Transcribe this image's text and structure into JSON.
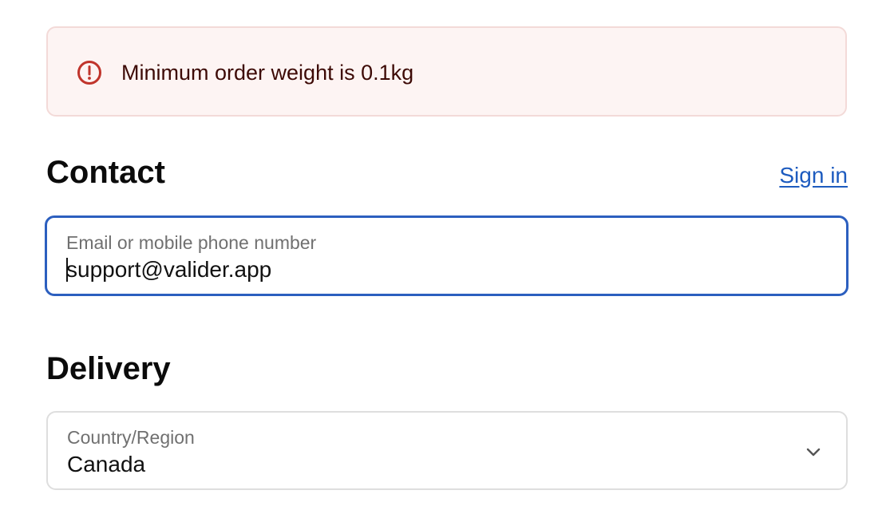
{
  "error_banner": {
    "icon": "alert-circle-icon",
    "message": "Minimum order weight is 0.1kg",
    "colors": {
      "background": "#fdf4f3",
      "border": "#f3dad8",
      "icon": "#c0342b",
      "text": "#3d0a06"
    }
  },
  "contact": {
    "heading": "Contact",
    "sign_in_label": "Sign in",
    "email_field": {
      "label": "Email or mobile phone number",
      "value": "support@valider.app",
      "focused": true
    }
  },
  "delivery": {
    "heading": "Delivery",
    "country_field": {
      "label": "Country/Region",
      "value": "Canada",
      "icon": "chevron-down-icon"
    }
  },
  "colors": {
    "accent": "#2c5fbf",
    "link": "#1d5bbf",
    "field_border": "#dedede",
    "label": "#707070"
  }
}
